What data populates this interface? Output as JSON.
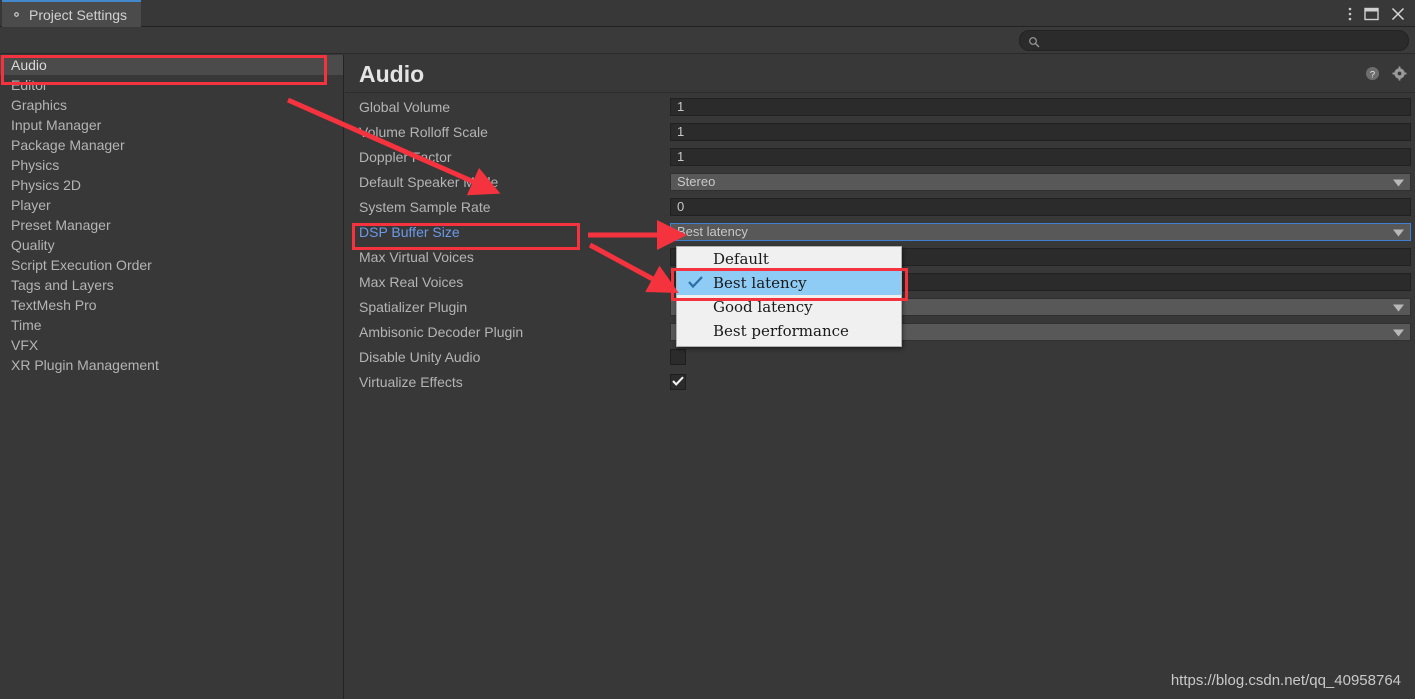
{
  "window": {
    "tab_label": "Project Settings",
    "tab_icon": "gear-icon",
    "controls": [
      "kebab-menu-icon",
      "maximize-icon",
      "close-icon"
    ],
    "accent_color": "#4387cc"
  },
  "search": {
    "value": "",
    "placeholder": "",
    "icon": "search-icon"
  },
  "sidebar": {
    "items": [
      {
        "label": "Audio",
        "selected": true
      },
      {
        "label": "Editor",
        "selected": false
      },
      {
        "label": "Graphics",
        "selected": false
      },
      {
        "label": "Input Manager",
        "selected": false
      },
      {
        "label": "Package Manager",
        "selected": false
      },
      {
        "label": "Physics",
        "selected": false
      },
      {
        "label": "Physics 2D",
        "selected": false
      },
      {
        "label": "Player",
        "selected": false
      },
      {
        "label": "Preset Manager",
        "selected": false
      },
      {
        "label": "Quality",
        "selected": false
      },
      {
        "label": "Script Execution Order",
        "selected": false
      },
      {
        "label": "Tags and Layers",
        "selected": false
      },
      {
        "label": "TextMesh Pro",
        "selected": false
      },
      {
        "label": "Time",
        "selected": false
      },
      {
        "label": "VFX",
        "selected": false
      },
      {
        "label": "XR Plugin Management",
        "selected": false
      }
    ]
  },
  "panel": {
    "title": "Audio",
    "help_icon": "help-icon",
    "settings_icon": "gear-icon",
    "rows": [
      {
        "label": "Global Volume",
        "kind": "text",
        "value": "1"
      },
      {
        "label": "Volume Rolloff Scale",
        "kind": "text",
        "value": "1"
      },
      {
        "label": "Doppler Factor",
        "kind": "text",
        "value": "1"
      },
      {
        "label": "Default Speaker Mode",
        "kind": "popup",
        "value": "Stereo"
      },
      {
        "label": "System Sample Rate",
        "kind": "text",
        "value": "0"
      },
      {
        "label": "DSP Buffer Size",
        "kind": "popup",
        "value": "Best latency",
        "focused": true,
        "label_accent": true
      },
      {
        "label": "Max Virtual Voices",
        "kind": "text",
        "value": ""
      },
      {
        "label": "Max Real Voices",
        "kind": "text",
        "value": ""
      },
      {
        "label": "Spatializer Plugin",
        "kind": "popup",
        "value": ""
      },
      {
        "label": "Ambisonic Decoder Plugin",
        "kind": "popup",
        "value": ""
      },
      {
        "label": "Disable Unity Audio",
        "kind": "checkbox",
        "checked": false
      },
      {
        "label": "Virtualize Effects",
        "kind": "checkbox",
        "checked": true
      }
    ]
  },
  "dropdown": {
    "open_for": "DSP Buffer Size",
    "options": [
      {
        "label": "Default",
        "selected": false
      },
      {
        "label": "Best latency",
        "selected": true
      },
      {
        "label": "Good latency",
        "selected": false
      },
      {
        "label": "Best performance",
        "selected": false
      }
    ],
    "selected_color": "#8ecbf5",
    "check_icon": "check-icon"
  },
  "annotations": {
    "color": "#f5333f",
    "boxes": [
      "sidebar-audio-item",
      "dsp-buffer-size-label",
      "dropdown-best-latency-option"
    ],
    "arrows": [
      "audio-to-settings-arrow",
      "dsp-label-to-field-arrow",
      "dsp-label-to-option-arrow"
    ]
  },
  "watermark": {
    "text": "https://blog.csdn.net/qq_40958764"
  }
}
